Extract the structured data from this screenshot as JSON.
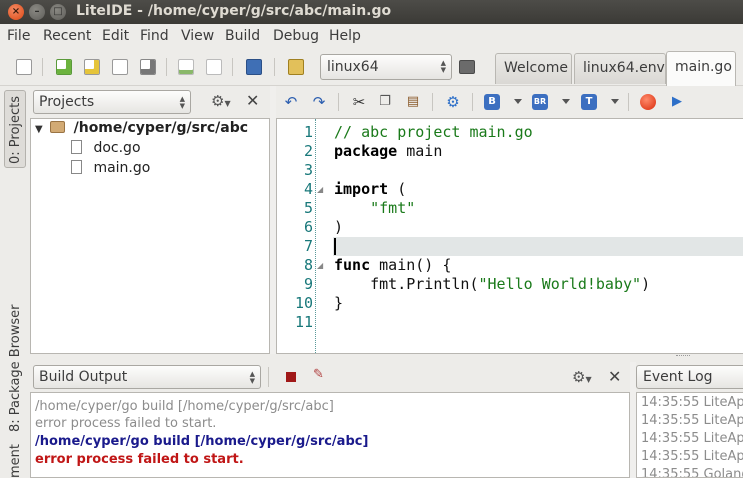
{
  "window": {
    "title": "LiteIDE - /home/cyper/g/src/abc/main.go"
  },
  "menu": [
    "File",
    "Recent",
    "Edit",
    "Find",
    "View",
    "Build",
    "Debug",
    "Help"
  ],
  "toolbar": {
    "environment": "linux64"
  },
  "tabs": [
    {
      "label": "Welcome"
    },
    {
      "label": "linux64.env"
    },
    {
      "label": "main.go"
    }
  ],
  "side_tabs": {
    "projects": "0: Projects",
    "package_browser": "8: Package Browser",
    "document": "ment"
  },
  "projects": {
    "selector": "Projects",
    "root": "/home/cyper/g/src/abc",
    "files": [
      "doc.go",
      "main.go"
    ]
  },
  "editor_badges": {
    "b": "B",
    "br": "BR",
    "t": "T"
  },
  "editor": {
    "line_numbers": [
      "1",
      "2",
      "3",
      "4",
      "5",
      "6",
      "7",
      "8",
      "9",
      "10",
      "11"
    ],
    "lines": [
      {
        "parts": [
          {
            "t": "// abc project main.go",
            "c": "cm"
          }
        ]
      },
      {
        "parts": [
          {
            "t": "package",
            "c": "kw"
          },
          {
            "t": " main",
            "c": ""
          }
        ]
      },
      {
        "parts": []
      },
      {
        "parts": [
          {
            "t": "import",
            "c": "kw"
          },
          {
            "t": " (",
            "c": ""
          }
        ]
      },
      {
        "parts": [
          {
            "t": "    ",
            "c": ""
          },
          {
            "t": "\"fmt\"",
            "c": "st"
          }
        ]
      },
      {
        "parts": [
          {
            "t": ")",
            "c": ""
          }
        ]
      },
      {
        "parts": []
      },
      {
        "parts": [
          {
            "t": "func",
            "c": "kw"
          },
          {
            "t": " main() {",
            "c": ""
          }
        ]
      },
      {
        "parts": [
          {
            "t": "    fmt.Println(",
            "c": ""
          },
          {
            "t": "\"Hello World!baby\"",
            "c": "st"
          },
          {
            "t": ")",
            "c": ""
          }
        ]
      },
      {
        "parts": [
          {
            "t": "}",
            "c": ""
          }
        ]
      },
      {
        "parts": []
      }
    ]
  },
  "build_output": {
    "selector": "Build Output",
    "lines": [
      {
        "text": "/home/cyper/go build  [/home/cyper/g/src/abc]",
        "style": "gray"
      },
      {
        "text": "error process failed to start.",
        "style": "gray"
      },
      {
        "text": "/home/cyper/go build  [/home/cyper/g/src/abc]",
        "style": "blue"
      },
      {
        "text": "error process failed to start.",
        "style": "red"
      }
    ]
  },
  "event_log": {
    "selector": "Event Log",
    "lines": [
      "14:35:55 LiteAp",
      "14:35:55 LiteAp",
      "14:35:55 LiteAp",
      "14:35:55 LiteAp",
      "14:35:55 Golang"
    ]
  }
}
